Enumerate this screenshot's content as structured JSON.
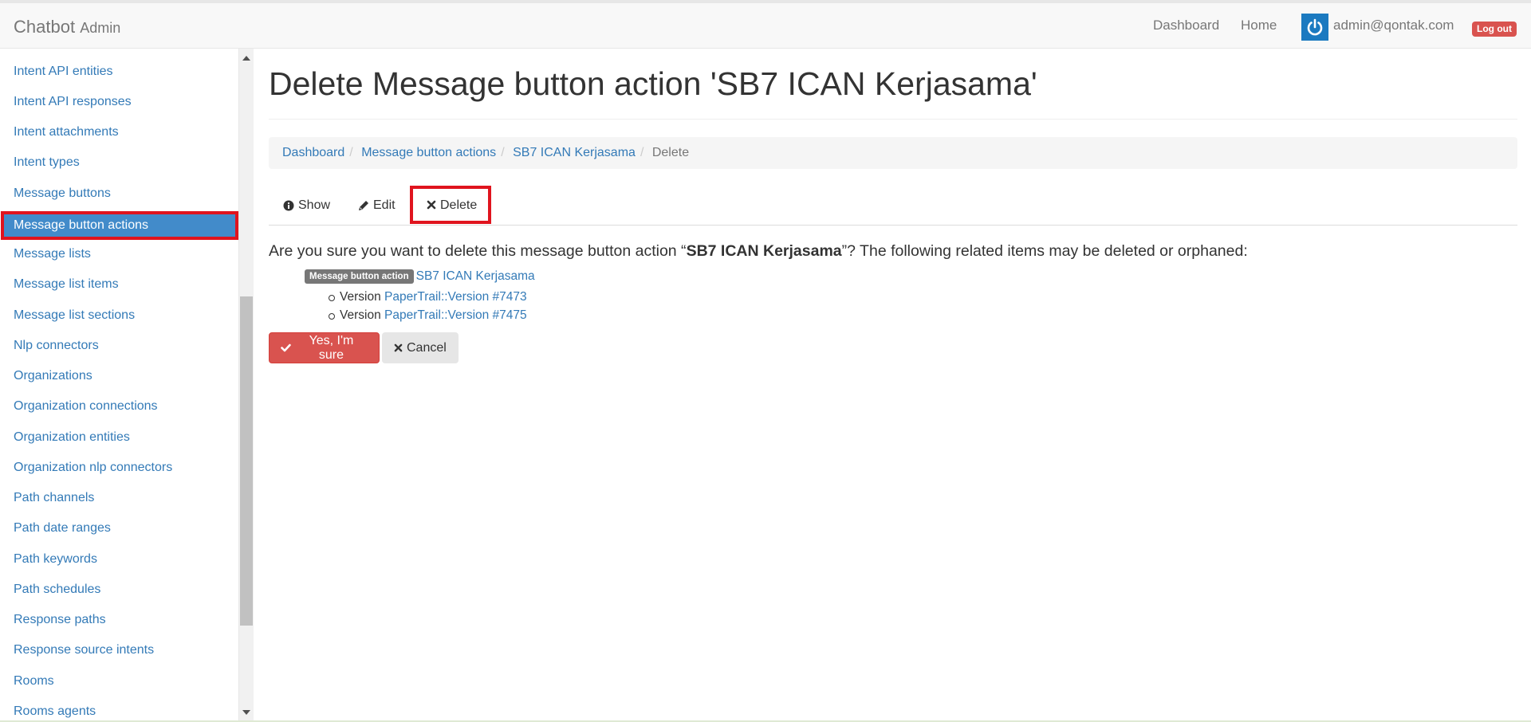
{
  "navbar": {
    "brand": "Chatbot",
    "brand_sub": "Admin",
    "dashboard_link": "Dashboard",
    "home_link": "Home",
    "user_email": "admin@qontak.com",
    "logout_label": "Log out"
  },
  "sidebar": {
    "items": [
      {
        "label": "Intent API entities",
        "active": false
      },
      {
        "label": "Intent API responses",
        "active": false
      },
      {
        "label": "Intent attachments",
        "active": false
      },
      {
        "label": "Intent types",
        "active": false
      },
      {
        "label": "Message buttons",
        "active": false
      },
      {
        "label": "Message button actions",
        "active": true
      },
      {
        "label": "Message lists",
        "active": false
      },
      {
        "label": "Message list items",
        "active": false
      },
      {
        "label": "Message list sections",
        "active": false
      },
      {
        "label": "Nlp connectors",
        "active": false
      },
      {
        "label": "Organizations",
        "active": false
      },
      {
        "label": "Organization connections",
        "active": false
      },
      {
        "label": "Organization entities",
        "active": false
      },
      {
        "label": "Organization nlp connectors",
        "active": false
      },
      {
        "label": "Path channels",
        "active": false
      },
      {
        "label": "Path date ranges",
        "active": false
      },
      {
        "label": "Path keywords",
        "active": false
      },
      {
        "label": "Path schedules",
        "active": false
      },
      {
        "label": "Response paths",
        "active": false
      },
      {
        "label": "Response source intents",
        "active": false
      },
      {
        "label": "Rooms",
        "active": false
      },
      {
        "label": "Rooms agents",
        "active": false
      }
    ]
  },
  "main": {
    "title": "Delete Message button action 'SB7 ICAN Kerjasama'",
    "breadcrumb": {
      "dashboard": "Dashboard",
      "section": "Message button actions",
      "record": "SB7 ICAN Kerjasama",
      "current": "Delete"
    },
    "tabs": {
      "show": "Show",
      "edit": "Edit",
      "delete": "Delete"
    },
    "confirm": {
      "prefix": "Are you sure you want to delete this message button action “",
      "object": "SB7 ICAN Kerjasama",
      "suffix": "”? The following related items may be deleted or orphaned:"
    },
    "related": {
      "label": "Message button action",
      "link": "SB7 ICAN Kerjasama",
      "versions": [
        {
          "prefix": "Version",
          "link": "PaperTrail::Version #7473"
        },
        {
          "prefix": "Version",
          "link": "PaperTrail::Version #7475"
        }
      ]
    },
    "buttons": {
      "confirm": "Yes, I'm sure",
      "cancel": "Cancel"
    }
  },
  "colors": {
    "link": "#337ab7",
    "active_bg": "#428bca",
    "highlight_border": "#e0141e",
    "danger": "#d9534f"
  }
}
